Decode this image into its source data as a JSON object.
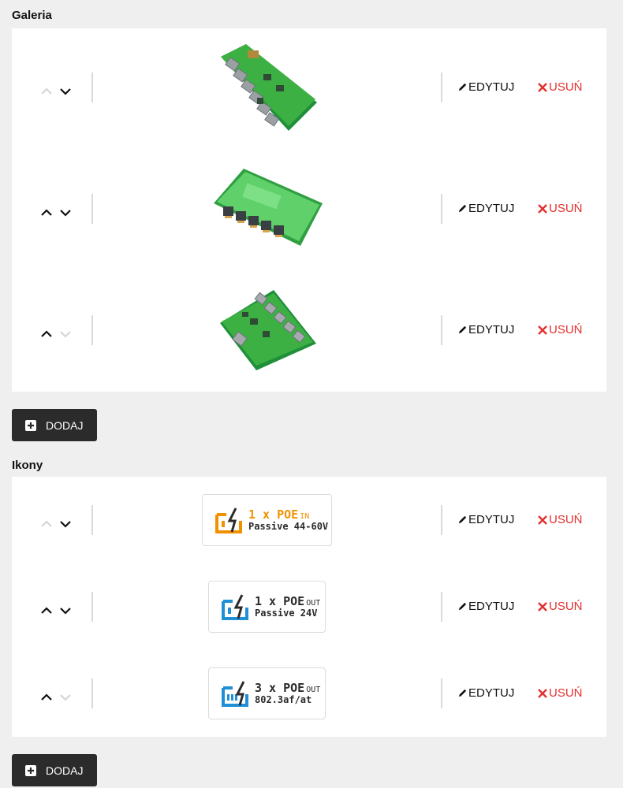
{
  "gallery": {
    "title": "Galeria",
    "rows": [
      {
        "up_enabled": false,
        "down_enabled": true,
        "image": "pcb-board-angled-1",
        "edit_label": "EDYTUJ",
        "delete_label": "USUŃ"
      },
      {
        "up_enabled": true,
        "down_enabled": true,
        "image": "pcb-board-front-ports",
        "edit_label": "EDYTUJ",
        "delete_label": "USUŃ"
      },
      {
        "up_enabled": true,
        "down_enabled": false,
        "image": "pcb-board-angled-2",
        "edit_label": "EDYTUJ",
        "delete_label": "USUŃ"
      }
    ],
    "add_label": "DODAJ"
  },
  "icons": {
    "title": "Ikony",
    "rows": [
      {
        "up_enabled": false,
        "down_enabled": true,
        "line1": "1 x POE",
        "suffix": "IN",
        "line2": "Passive 44-60V",
        "accent": "#f29100",
        "glyph": "poe-in-icon",
        "edit_label": "EDYTUJ",
        "delete_label": "USUŃ"
      },
      {
        "up_enabled": true,
        "down_enabled": true,
        "line1": "1 x POE",
        "suffix": "OUT",
        "line2": "Passive 24V",
        "accent": "#1f8fd6",
        "glyph": "poe-out-icon",
        "edit_label": "EDYTUJ",
        "delete_label": "USUŃ"
      },
      {
        "up_enabled": true,
        "down_enabled": false,
        "line1": "3 x POE",
        "suffix": "OUT",
        "line2": "802.3af/at",
        "accent": "#1f8fd6",
        "glyph": "poe-out-3-icon",
        "edit_label": "EDYTUJ",
        "delete_label": "USUŃ"
      }
    ],
    "add_label": "DODAJ"
  },
  "colors": {
    "delete": "#e2312f",
    "add_button_bg": "#2b2b2b",
    "pcb_green": "#3cb043"
  }
}
